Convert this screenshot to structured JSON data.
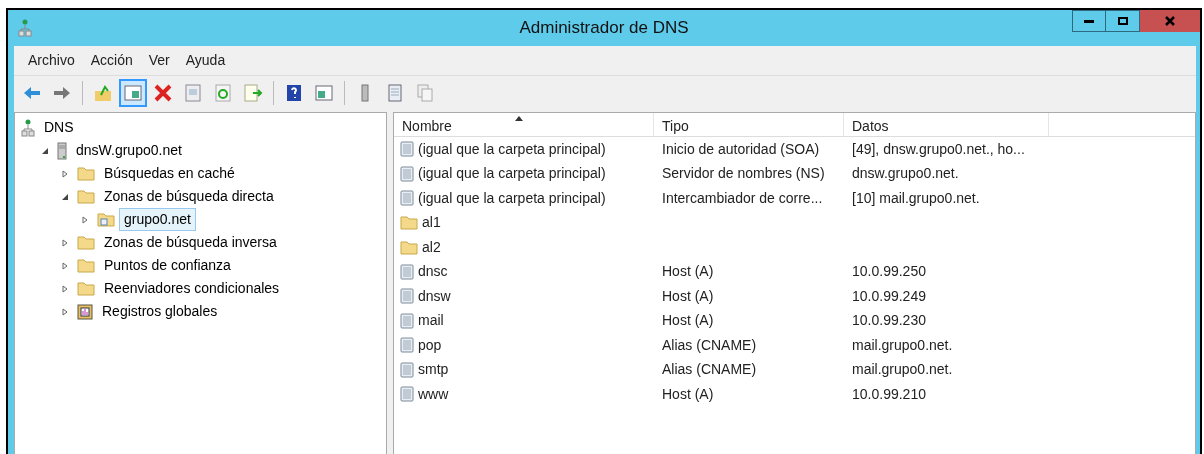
{
  "window": {
    "title": "Administrador de DNS"
  },
  "menu": [
    "Archivo",
    "Acción",
    "Ver",
    "Ayuda"
  ],
  "toolbar": [
    {
      "items": [
        {
          "kind": "back",
          "selected": false
        },
        {
          "kind": "forward",
          "selected": false
        }
      ]
    },
    {
      "items": [
        {
          "kind": "up",
          "selected": false
        },
        {
          "kind": "pane",
          "selected": true
        },
        {
          "kind": "delete",
          "selected": false
        },
        {
          "kind": "props",
          "selected": false
        },
        {
          "kind": "refresh",
          "selected": false
        },
        {
          "kind": "export",
          "selected": false
        }
      ]
    },
    {
      "items": [
        {
          "kind": "help",
          "selected": false
        },
        {
          "kind": "pane2",
          "selected": false
        }
      ]
    },
    {
      "items": [
        {
          "kind": "server",
          "selected": false
        },
        {
          "kind": "record",
          "selected": false
        },
        {
          "kind": "copy",
          "selected": false
        }
      ]
    }
  ],
  "tree": [
    {
      "label": "DNS",
      "kind": "root",
      "selected": false,
      "children": [
        {
          "label": "dnsW.grupo0.net",
          "kind": "server",
          "expanded": true,
          "selected": false,
          "children": [
            {
              "label": "Búsquedas en caché",
              "kind": "folder",
              "expanded": false,
              "selected": false
            },
            {
              "label": "Zonas de búsqueda directa",
              "kind": "folder",
              "expanded": true,
              "selected": false,
              "children": [
                {
                  "label": "grupo0.net",
                  "kind": "zone",
                  "expanded": false,
                  "selected": true
                }
              ]
            },
            {
              "label": "Zonas de búsqueda inversa",
              "kind": "folder",
              "expanded": false,
              "selected": false
            },
            {
              "label": "Puntos de confianza",
              "kind": "folder",
              "expanded": false,
              "selected": false
            },
            {
              "label": "Reenviadores condicionales",
              "kind": "folder",
              "expanded": false,
              "selected": false
            },
            {
              "label": "Registros globales",
              "kind": "global",
              "expanded": false,
              "selected": false
            }
          ]
        }
      ]
    }
  ],
  "table": {
    "columns": [
      "Nombre",
      "Tipo",
      "Datos"
    ],
    "rows": [
      {
        "kind": "record",
        "name": "(igual que la carpeta principal)",
        "type": "Inicio de autoridad (SOA)",
        "data": "[49], dnsw.grupo0.net., ho..."
      },
      {
        "kind": "record",
        "name": "(igual que la carpeta principal)",
        "type": "Servidor de nombres (NS)",
        "data": "dnsw.grupo0.net."
      },
      {
        "kind": "record",
        "name": "(igual que la carpeta principal)",
        "type": "Intercambiador de corre...",
        "data": "[10]  mail.grupo0.net."
      },
      {
        "kind": "folder",
        "name": "al1"
      },
      {
        "kind": "folder",
        "name": "al2"
      },
      {
        "kind": "record",
        "name": "dnsc",
        "type": "Host (A)",
        "data": "10.0.99.250"
      },
      {
        "kind": "record",
        "name": "dnsw",
        "type": "Host (A)",
        "data": "10.0.99.249"
      },
      {
        "kind": "record",
        "name": "mail",
        "type": "Host (A)",
        "data": "10.0.99.230"
      },
      {
        "kind": "record",
        "name": "pop",
        "type": "Alias (CNAME)",
        "data": "mail.grupo0.net."
      },
      {
        "kind": "record",
        "name": "smtp",
        "type": "Alias (CNAME)",
        "data": "mail.grupo0.net."
      },
      {
        "kind": "record",
        "name": "www",
        "type": "Host (A)",
        "data": "10.0.99.210"
      }
    ]
  }
}
